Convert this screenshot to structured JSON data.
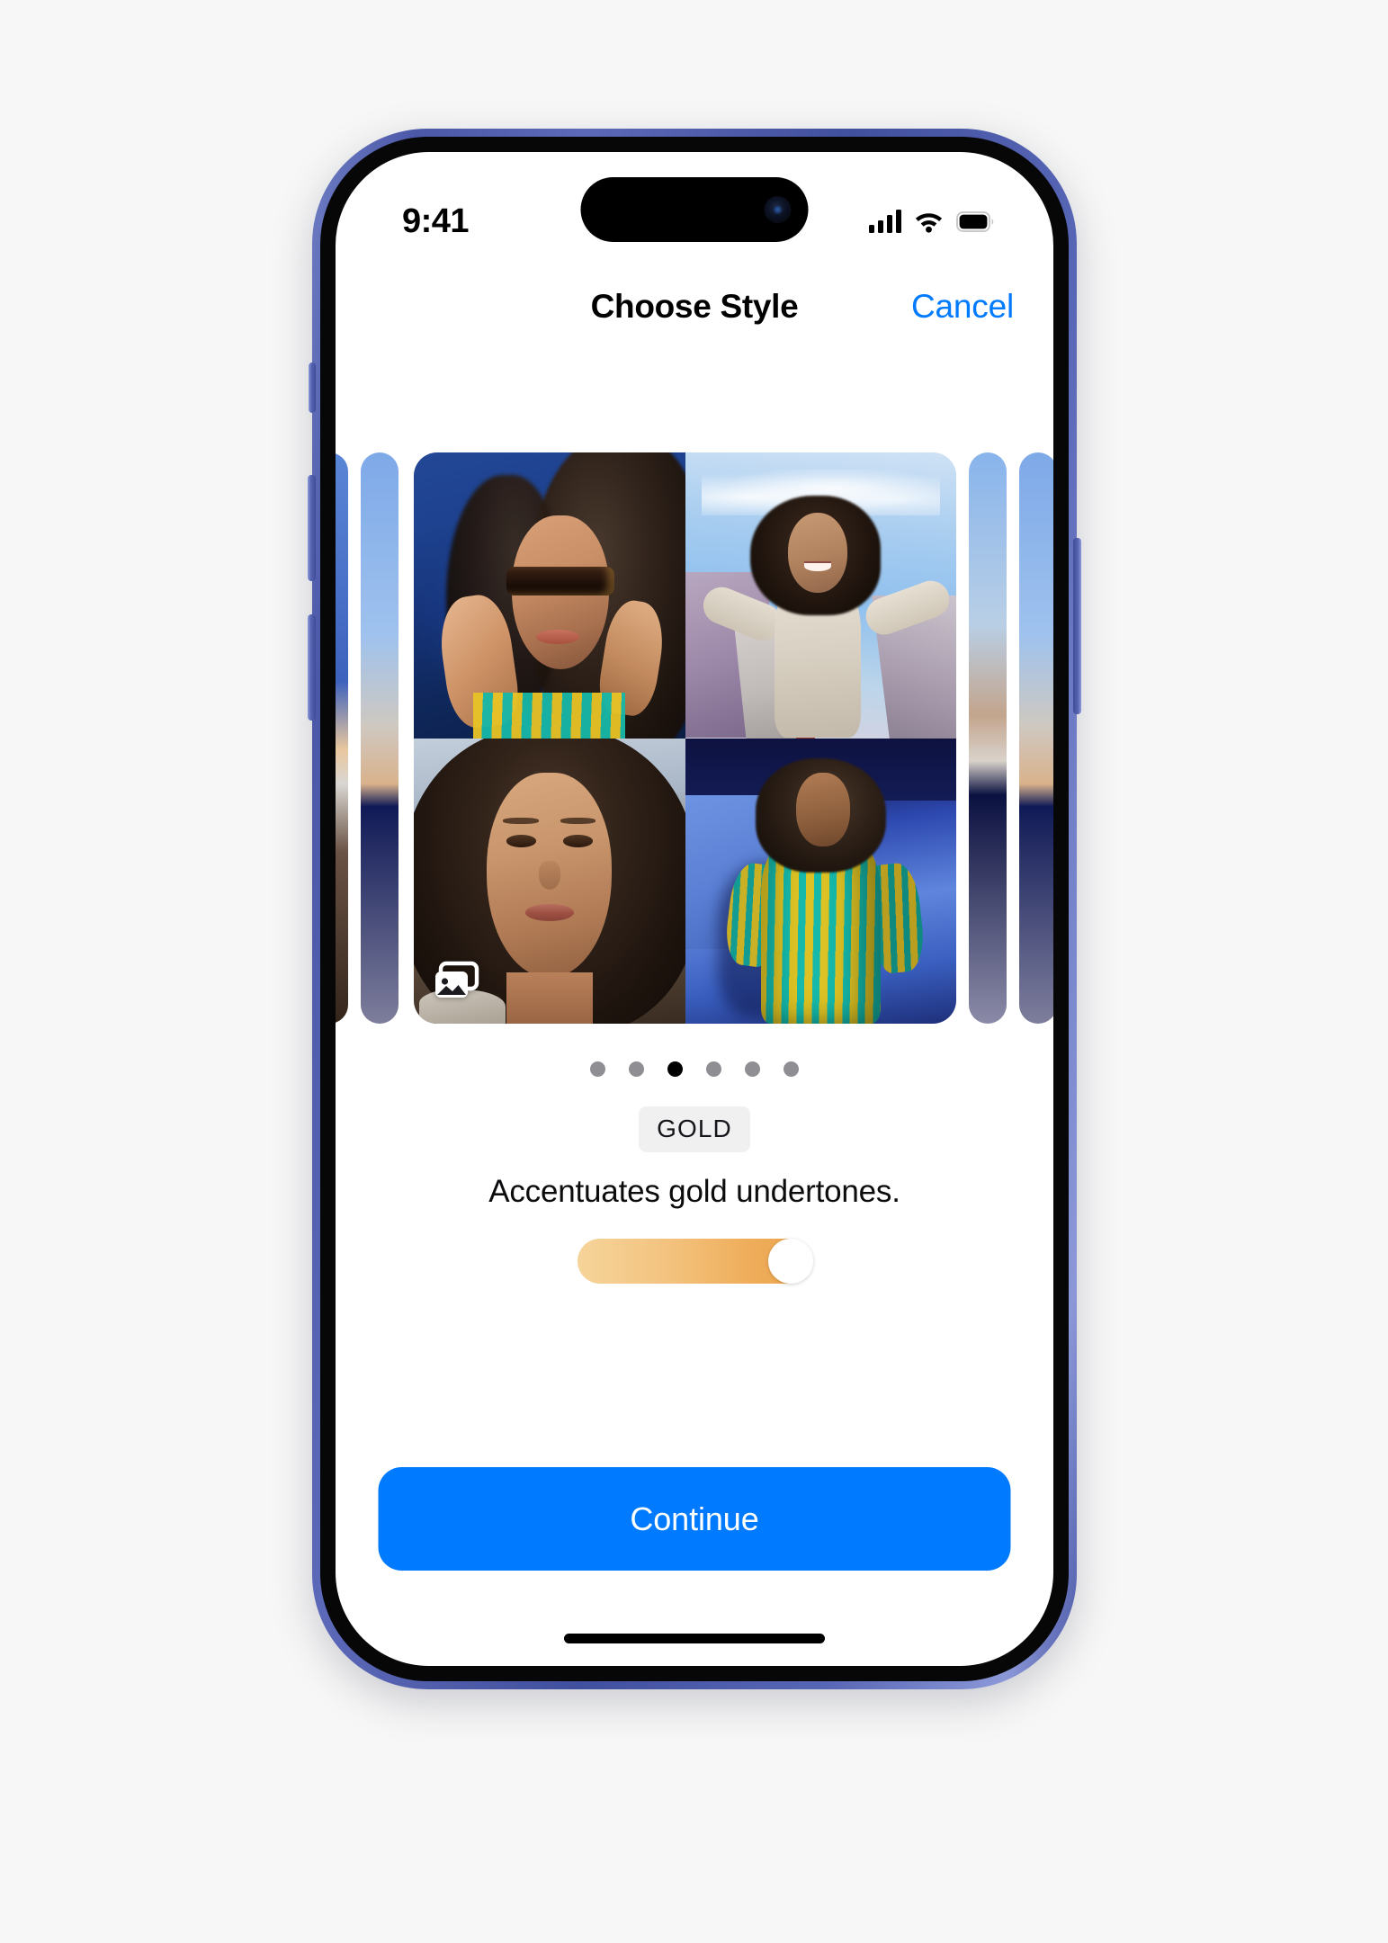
{
  "status_bar": {
    "time": "9:41",
    "cellular_icon": "cellular-signal-icon",
    "wifi_icon": "wifi-icon",
    "battery_icon": "battery-icon"
  },
  "nav": {
    "title": "Choose Style",
    "cancel_label": "Cancel"
  },
  "carousel": {
    "photos": [
      {
        "name": "photo-sunglasses-blue-wall"
      },
      {
        "name": "photo-sky-structures"
      },
      {
        "name": "photo-closeup-portrait",
        "badge_icon": "photo-stack-icon"
      },
      {
        "name": "photo-striped-dress-blue-wall"
      }
    ],
    "peek_left_count": 2,
    "peek_right_count": 2
  },
  "pagination": {
    "total": 6,
    "active_index": 2
  },
  "style": {
    "badge_label": "GOLD",
    "description": "Accentuates gold undertones.",
    "slider_value_percent": 100,
    "slider_gradient_start": "#f6d49a",
    "slider_gradient_end": "#eda349"
  },
  "actions": {
    "continue_label": "Continue"
  },
  "colors": {
    "accent_blue": "#007aff",
    "page_background": "#f7f7f7",
    "badge_background": "#f0f0f1",
    "dot_inactive": "#8e8e93",
    "dot_active": "#000000"
  }
}
